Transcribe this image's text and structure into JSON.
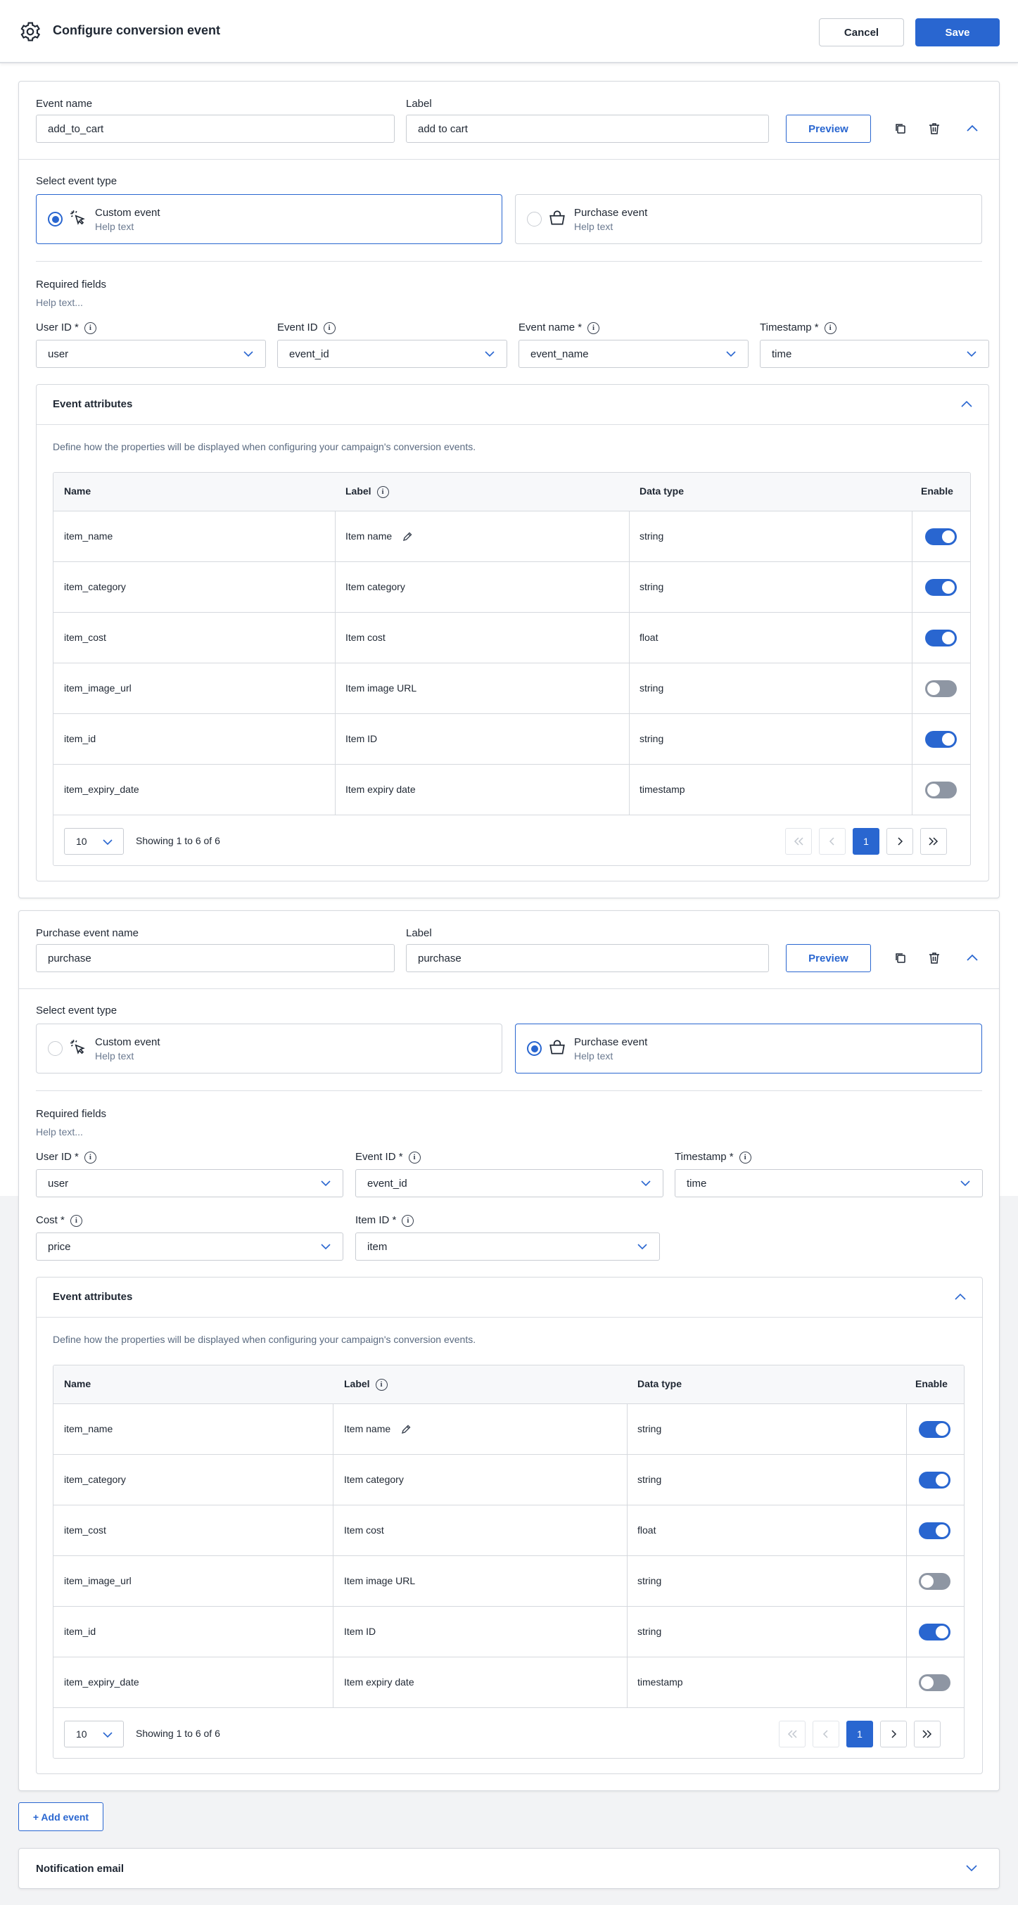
{
  "header": {
    "title": "Configure conversion event",
    "cancel_label": "Cancel",
    "save_label": "Save"
  },
  "common": {
    "preview_label": "Preview",
    "select_type_label": "Select event type",
    "custom_event": "Custom event",
    "purchase_event": "Purchase event",
    "type_help": "Help text",
    "required_fields": "Required fields",
    "required_help": "Help text...",
    "attributes_title": "Event attributes",
    "attributes_desc": "Define how the properties will be displayed when configuring your campaign's conversion events.",
    "col_name": "Name",
    "col_label": "Label",
    "col_type": "Data type",
    "col_enable": "Enable",
    "page_size": "10",
    "showing": "Showing 1 to 6 of 6",
    "current_page": "1"
  },
  "event1": {
    "name_label": "Event name",
    "name_value": "add_to_cart",
    "label_label": "Label",
    "label_value": "add to cart",
    "selected_type": "custom",
    "fields": [
      {
        "label": "User ID *",
        "value": "user"
      },
      {
        "label": "Event ID",
        "value": "event_id"
      },
      {
        "label": "Event name *",
        "value": "event_name"
      },
      {
        "label": "Timestamp *",
        "value": "time"
      }
    ]
  },
  "event2": {
    "name_label": "Purchase event name",
    "name_value": "purchase",
    "label_label": "Label",
    "label_value": "purchase",
    "selected_type": "purchase",
    "fields": [
      {
        "label": "User ID *",
        "value": "user"
      },
      {
        "label": "Event ID *",
        "value": "event_id"
      },
      {
        "label": "Timestamp *",
        "value": "time"
      },
      {
        "label": "Cost *",
        "value": "price"
      },
      {
        "label": "Item ID *",
        "value": "item"
      }
    ]
  },
  "attributes": [
    {
      "name": "item_name",
      "label": "Item name",
      "type": "string",
      "enabled": true
    },
    {
      "name": "item_category",
      "label": "Item category",
      "type": "string",
      "enabled": true
    },
    {
      "name": "item_cost",
      "label": "Item cost",
      "type": "float",
      "enabled": true
    },
    {
      "name": "item_image_url",
      "label": "Item image URL",
      "type": "string",
      "enabled": false
    },
    {
      "name": "item_id",
      "label": "Item ID",
      "type": "string",
      "enabled": true
    },
    {
      "name": "item_expiry_date",
      "label": "Item expiry date",
      "type": "timestamp",
      "enabled": false
    }
  ],
  "footer": {
    "add_event_label": "+ Add event",
    "notification_label": "Notification email"
  },
  "colors": {
    "accent": "#2966d0",
    "toggle_off": "#8e96a3",
    "help_text": "#6b7a90"
  },
  "icons": [
    "gear-icon",
    "copy-icon",
    "trash-icon",
    "chevron-up-icon",
    "chevron-down-icon",
    "cursor-click-icon",
    "shopping-bag-icon",
    "info-icon",
    "pencil-icon",
    "first-page-icon",
    "prev-page-icon",
    "next-page-icon",
    "last-page-icon"
  ]
}
